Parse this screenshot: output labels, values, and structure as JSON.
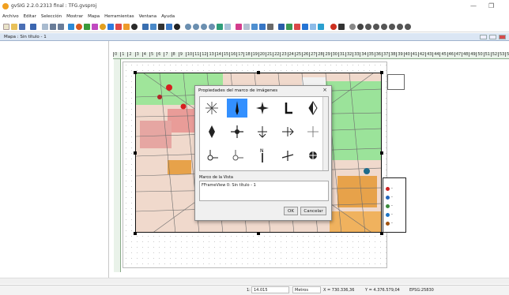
{
  "window": {
    "title": "gvSIG 2.2.0.2313 final : TFG.gvsproj",
    "minimize": "—",
    "maximize": "❐"
  },
  "menu": [
    "Archivo",
    "Editar",
    "Selección",
    "Mostrar",
    "Mapa",
    "Herramientas",
    "Ventana",
    "Ayuda"
  ],
  "doc_tab": {
    "label": "Mapa : Sin título - 1"
  },
  "ruler": {
    "ticks": [
      "0",
      "1",
      "2",
      "3",
      "4",
      "5",
      "6",
      "7",
      "8",
      "9",
      "10",
      "11",
      "12",
      "13",
      "14",
      "15",
      "16",
      "17",
      "18",
      "19",
      "20",
      "21",
      "22",
      "23",
      "24",
      "25",
      "26",
      "27",
      "28",
      "29",
      "30",
      "31",
      "32",
      "33",
      "34",
      "35",
      "36",
      "37",
      "38",
      "39",
      "40",
      "41",
      "42",
      "43",
      "44",
      "45",
      "46",
      "47",
      "48",
      "49",
      "50",
      "51",
      "52",
      "53",
      "54"
    ]
  },
  "dialog": {
    "title": "Propiedades del marco de imágenes",
    "close": "×",
    "section_label": "Marco de la Vista",
    "list_item": "FFrameView 0: Sin título - 1",
    "ok": "OK",
    "cancel": "Cancelar"
  },
  "legend": {
    "rows": [
      {
        "color": "#cc1f1f",
        "label": "-"
      },
      {
        "color": "#2266bb",
        "label": "-"
      },
      {
        "color": "#3a8a3a",
        "label": "-"
      },
      {
        "color": "#1e74c4",
        "label": "-"
      },
      {
        "color": "#a0520f",
        "label": "-"
      }
    ]
  },
  "status": {
    "scale_prefix": "1:",
    "scale": "14.015",
    "units": "Metros",
    "x": "X = 730.336,36",
    "y": "Y = 4.376.579,04",
    "epsg": "EPSG:25830"
  }
}
